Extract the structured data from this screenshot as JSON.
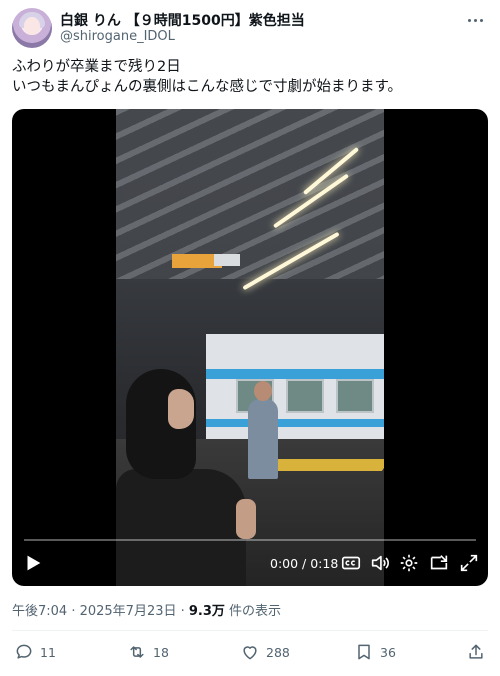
{
  "author": {
    "display_name": "白銀 りん 【９時間1500円】紫色担当",
    "handle": "@shirogane_IDOL"
  },
  "tweet": {
    "line1": "ふわりが卒業まで残り2日",
    "line2": "いつもまんぴょんの裏側はこんな感じで寸劇が始まります。"
  },
  "video": {
    "time": "0:00 / 0:18",
    "progress": 0.0
  },
  "meta": {
    "timestamp": "午後7:04 · 2025年7月23日 · ",
    "views": "9.3万",
    "views_suffix": " 件の表示"
  },
  "actions": {
    "replies": "11",
    "reposts": "18",
    "likes": "288",
    "bookmarks": "36"
  },
  "colors": {
    "accent": "#1d9bf0",
    "muted": "#536471"
  }
}
